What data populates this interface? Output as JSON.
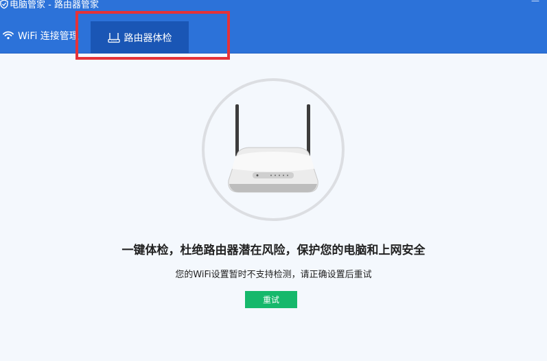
{
  "window": {
    "title": "电脑管家 - 路由器管家",
    "close_glyph": "—"
  },
  "tabs": [
    {
      "label": "WiFi 连接管理",
      "icon": "wifi-icon",
      "active": false
    },
    {
      "label": "路由器体检",
      "icon": "router-icon",
      "active": true
    }
  ],
  "main": {
    "headline": "一键体检，杜绝路由器潜在风险，保护您的电脑和上网安全",
    "message": "您的WiFi设置暂时不支持检测，请正确设置后重试",
    "retry_label": "重试"
  },
  "colors": {
    "header": "#2c72d9",
    "active_tab": "#1a56b5",
    "highlight": "#e53238",
    "retry": "#16b86b"
  }
}
